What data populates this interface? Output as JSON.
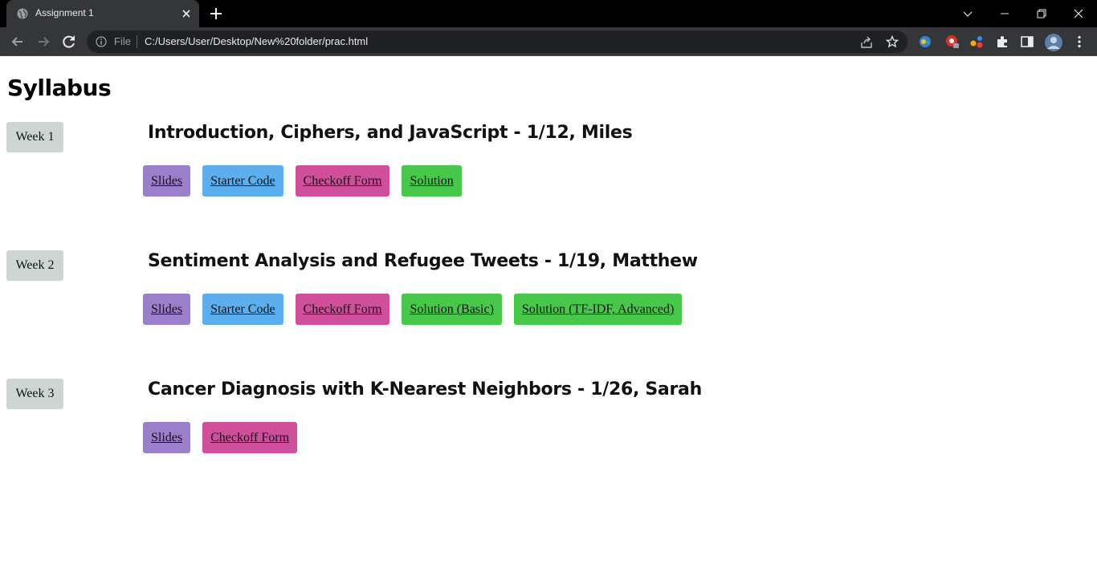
{
  "browser": {
    "tab_title": "Assignment 1",
    "omnibox": {
      "scheme_label": "File",
      "url": "C:/Users/User/Desktop/New%20folder/prac.html"
    }
  },
  "page": {
    "title": "Syllabus",
    "weeks": [
      {
        "badge": "Week 1",
        "title": "Introduction, Ciphers, and JavaScript - 1/12, Miles",
        "links": [
          {
            "label": "Slides",
            "kind": "slides"
          },
          {
            "label": "Starter Code",
            "kind": "starter"
          },
          {
            "label": "Checkoff Form",
            "kind": "checkoff"
          },
          {
            "label": "Solution",
            "kind": "solution"
          }
        ]
      },
      {
        "badge": "Week 2",
        "title": "Sentiment Analysis and Refugee Tweets - 1/19, Matthew",
        "links": [
          {
            "label": "Slides",
            "kind": "slides"
          },
          {
            "label": "Starter Code",
            "kind": "starter"
          },
          {
            "label": "Checkoff Form",
            "kind": "checkoff"
          },
          {
            "label": "Solution (Basic)",
            "kind": "solution"
          },
          {
            "label": "Solution (TF-IDF, Advanced)",
            "kind": "solution"
          }
        ]
      },
      {
        "badge": "Week 3",
        "title": "Cancer Diagnosis with K-Nearest Neighbors - 1/26, Sarah",
        "links": [
          {
            "label": "Slides",
            "kind": "slides"
          },
          {
            "label": "Checkoff Form",
            "kind": "checkoff"
          }
        ]
      }
    ]
  },
  "colors": {
    "slides": "#9b7fcb",
    "starter": "#5caeec",
    "checkoff": "#d04f9c",
    "solution": "#48c84a",
    "week_badge": "#ced5d5"
  },
  "icons": [
    "globe-icon",
    "close-icon",
    "plus-icon",
    "chevron-down-icon",
    "minimize-icon",
    "restore-icon",
    "back-arrow-icon",
    "forward-arrow-icon",
    "reload-icon",
    "info-icon",
    "share-icon",
    "star-icon",
    "extension-puzzle-icon",
    "side-panel-icon",
    "kebab-menu-icon"
  ]
}
